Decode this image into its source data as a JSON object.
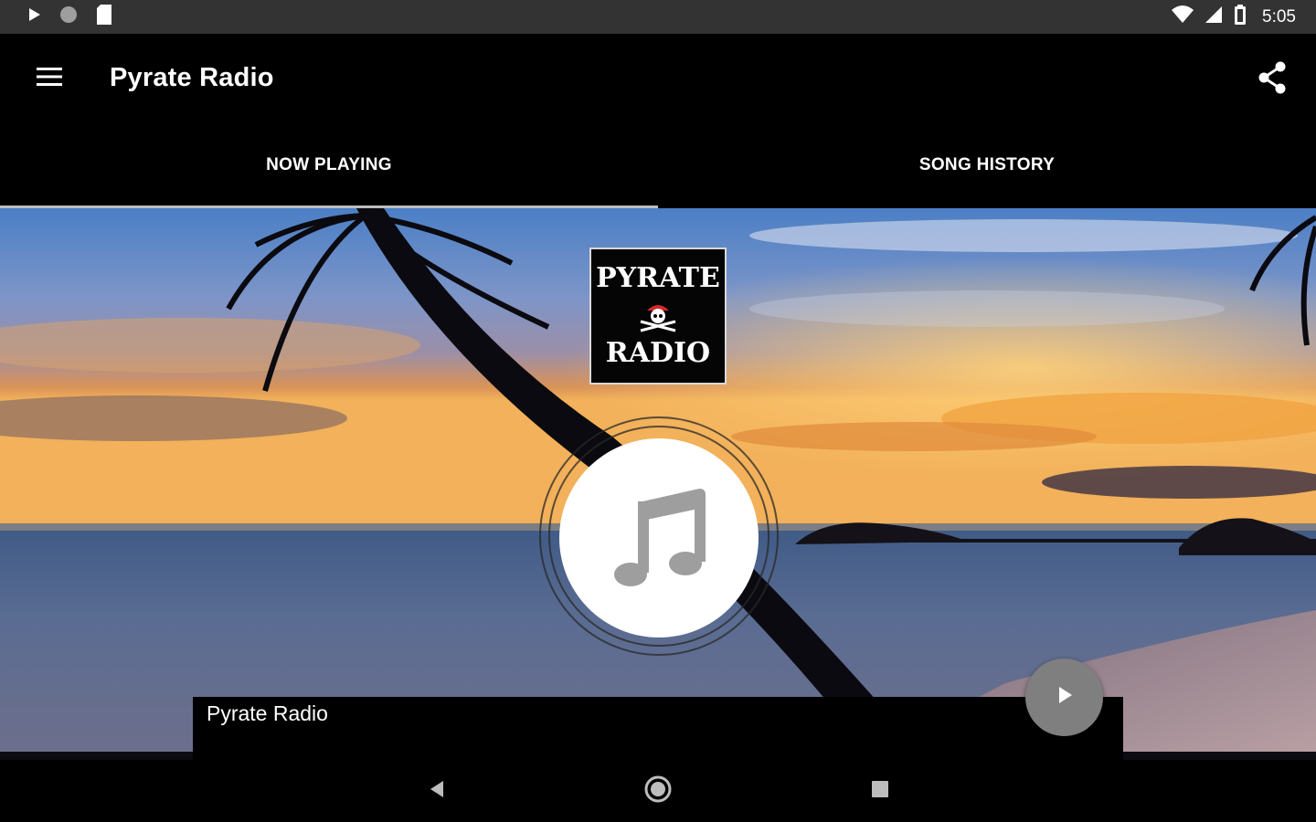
{
  "status_bar": {
    "time": "5:05",
    "left_icons": [
      "play-icon",
      "circle-icon",
      "sd-card-icon"
    ],
    "right_icons": [
      "wifi-icon",
      "cell-signal-icon",
      "battery-icon"
    ]
  },
  "toolbar": {
    "title": "Pyrate Radio",
    "menu_icon": "menu-icon",
    "share_icon": "share-icon"
  },
  "tabs": [
    {
      "label": "NOW PLAYING",
      "active": true
    },
    {
      "label": "SONG HISTORY",
      "active": false
    }
  ],
  "logo": {
    "line1": "PYRATE",
    "line2": "RADIO"
  },
  "player": {
    "station_name": "Pyrate Radio",
    "artwork_icon": "music-note-icon",
    "play_icon": "play-icon"
  },
  "nav_bar": {
    "icons": [
      "back-icon",
      "home-icon",
      "recents-icon"
    ]
  },
  "colors": {
    "status_bar": "#333333",
    "toolbar": "#000000",
    "tab_indicator": "#bdbdbd",
    "fab": "#7f7f7f"
  }
}
